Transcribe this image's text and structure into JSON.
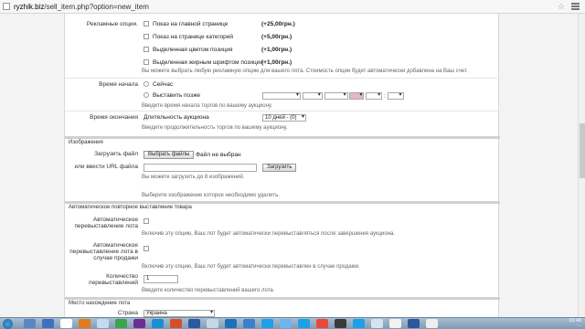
{
  "browser": {
    "url_host": "ryzhik.biz",
    "url_path": "/sell_item.php?option=new_item"
  },
  "ads": {
    "label": "Рекламные опции.",
    "options": [
      {
        "label": "Показ на главной странице",
        "price": "(+25,00грн.)"
      },
      {
        "label": "Показ на странице категорий",
        "price": "(+5,00грн.)"
      },
      {
        "label": "Выделенная цветом позиция",
        "price": "(+1,00грн.)"
      },
      {
        "label": "Выделенная жирным шрифтом позиция",
        "price": "(+1,00грн.)"
      }
    ],
    "hint": "Вы можете выбрать любую рекламную опцию для вашего лота. Стоимость опции будет автоматически добавлена на Ваш счет."
  },
  "start_time": {
    "label": "Время начала",
    "now": "Сейчас",
    "later": "Выставить позже",
    "hint": "Введите время начала торгов по вашему аукциону."
  },
  "end_time": {
    "label": "Время окончания",
    "duration_label": "Длительность аукциона",
    "duration_value": "10 дней - (0)",
    "hint": "Введите продолжительность торгов по вашему аукциону."
  },
  "images": {
    "section_title": "Изображения",
    "upload_label": "Загрузить файл",
    "choose_button": "Выбрать файлы",
    "no_file": "Файл не выбран",
    "url_label": "или ввести URL файла",
    "upload_button": "Загрузить",
    "hint_count": "Вы можете загрузить до 8 изображений.",
    "hint_delete": "Выберите изображение которое необходимо удалить."
  },
  "relist": {
    "section_title": "Автоматическое повторное выставление товара",
    "auto_label": "Автоматическое перевыставление лота",
    "auto_hint": "Включив эту опцию, Ваш лот будет автоматически перевыставляться после завершения аукциона.",
    "unsold_label": "Автоматическое перевыставление лота в случае продажи",
    "unsold_hint": "Включив эту опцию, Ваш лот будет автоматически перевыставлен в случае продажи.",
    "count_label": "Количество перевыставлений",
    "count_value": "1",
    "count_hint": "Введите количество перевыставлений вашего лота."
  },
  "location": {
    "section_title": "Место нахождение лота",
    "country_label": "Страна",
    "country_value": "Украина"
  },
  "taskbar": {
    "time": "19:48",
    "date": "..."
  }
}
